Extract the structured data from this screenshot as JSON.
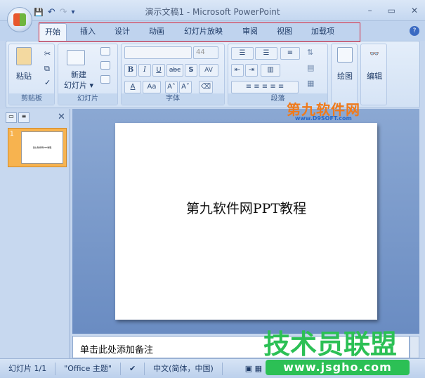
{
  "window": {
    "title": "演示文稿1 - Microsoft PowerPoint",
    "minimize": "–",
    "maximize": "▭",
    "close": "✕"
  },
  "qat": {
    "save": "💾",
    "undo": "↶",
    "redo": "↷",
    "customize": "▾"
  },
  "tabs": [
    "开始",
    "插入",
    "设计",
    "动画",
    "幻灯片放映",
    "审阅",
    "视图",
    "加载项"
  ],
  "ribbon": {
    "clipboard": {
      "label": "剪贴板",
      "paste": "粘贴"
    },
    "slides": {
      "label": "幻灯片",
      "new_slide_1": "新建",
      "new_slide_2": "幻灯片 ▾"
    },
    "font": {
      "label": "字体",
      "font_size": "44",
      "bold": "B",
      "italic": "I",
      "underline": "U",
      "strike": "abc",
      "shadow": "S",
      "spacing": "AV",
      "color": "A",
      "case": "Aa",
      "grow": "A˄",
      "shrink": "A˅"
    },
    "paragraph": {
      "label": "段落"
    },
    "drawing": {
      "label": "绘图"
    },
    "editing": {
      "label": "编辑"
    }
  },
  "slide_pane": {
    "thumb_number": "1",
    "thumb_text": "第九软件网PPT教程"
  },
  "slide": {
    "title": "第九软件网PPT教程"
  },
  "notes": {
    "placeholder": "单击此处添加备注"
  },
  "status": {
    "slide": "幻灯片 1/1",
    "theme": "\"Office 主题\"",
    "language": "中文(简体，中国)"
  },
  "watermarks": {
    "d9soft": "第九软件网",
    "d9soft_url": "www.D9SOFT.com",
    "jsgho": "技术员联盟",
    "jsgho_url": "www.jsgho.com"
  },
  "colors": {
    "highlight_box": "#d8263a",
    "ribbon_bg": "#d2e1f4",
    "stage_bg": "#6a8cc2"
  }
}
